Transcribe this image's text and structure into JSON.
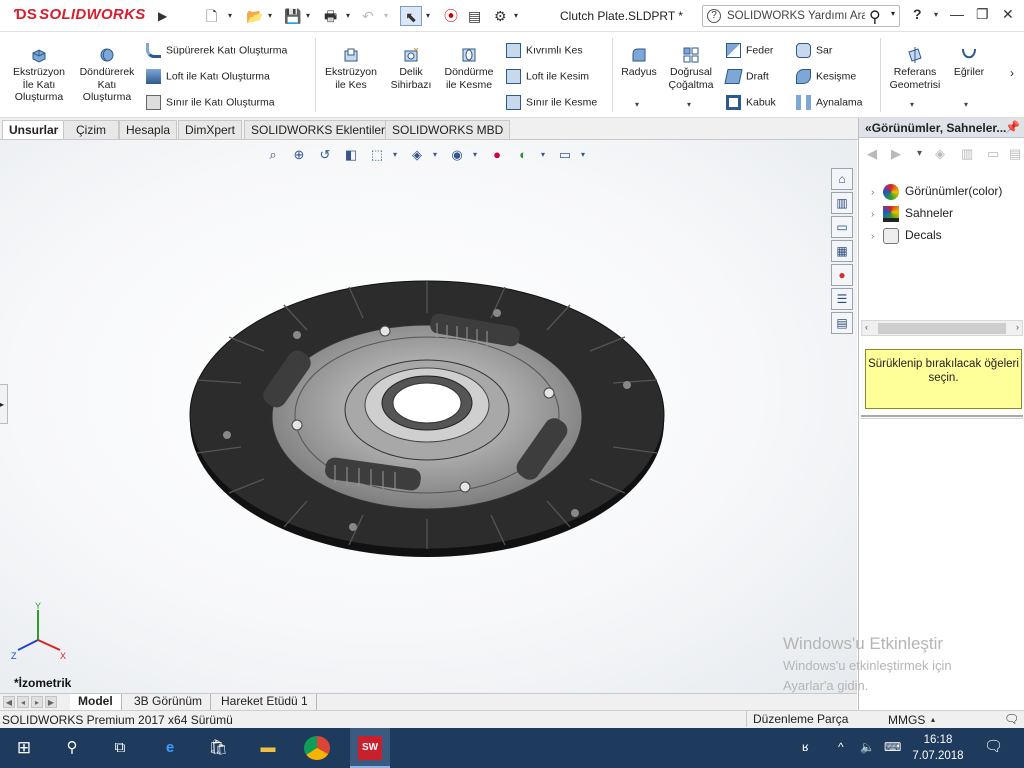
{
  "app": {
    "logo_text": "SOLIDWORKS",
    "document_title": "Clutch Plate.SLDPRT *",
    "help_search_placeholder": "SOLIDWORKS Yardımı Ara",
    "help_button": "?"
  },
  "ribbon": {
    "groups": [
      {
        "label": "Ekstrüzyon İle Katı Oluşturma",
        "lines": [
          "Ekstrüzyon",
          "İle Katı",
          "Oluşturma"
        ]
      },
      {
        "label": "Döndürerek Katı Oluşturma",
        "lines": [
          "Döndürerek",
          "Katı",
          "Oluşturma"
        ]
      }
    ],
    "sweep_loft": [
      "Süpürerek Katı Oluşturma",
      "Loft ile Katı Oluşturma",
      "Sınır ile Katı Oluşturma"
    ],
    "cut": {
      "extrude_cut": [
        "Ekstrüzyon",
        "ile Kes"
      ],
      "hole_wizard": [
        "Delik",
        "Sihirbazı"
      ],
      "revolve_cut": [
        "Döndürme",
        "ile Kesme"
      ]
    },
    "cut_small": [
      "Kıvrımlı Kes",
      "Loft ile Kesim",
      "Sınır ile Kesme"
    ],
    "fillet": "Radyus",
    "linear_pattern": [
      "Doğrusal",
      "Çoğaltma"
    ],
    "features_col1": [
      "Feder",
      "Draft",
      "Kabuk"
    ],
    "features_col2": [
      "Sar",
      "Kesişme",
      "Aynalama"
    ],
    "ref_geometry": [
      "Referans",
      "Geometrisi"
    ],
    "curves": "Eğriler"
  },
  "tabs": [
    "Unsurlar",
    "Çizim",
    "Hesapla",
    "DimXpert",
    "SOLIDWORKS Eklentileri",
    "SOLIDWORKS MBD"
  ],
  "active_tab": "Unsurlar",
  "viewport": {
    "view_orientation": "*İzometrik",
    "axis_labels": {
      "x": "X",
      "y": "Y",
      "z": "Z"
    }
  },
  "bottom_tabs": [
    "Model",
    "3B Görünüm",
    "Hareket Etüdü 1"
  ],
  "status": {
    "version": "SOLIDWORKS Premium 2017 x64 Sürümü",
    "mode": "Düzenleme Parça",
    "units": "MMGS"
  },
  "taskpane": {
    "header": "Görünümler, Sahneler...",
    "tree": [
      "Görünümler(color)",
      "Sahneler",
      "Decals"
    ],
    "message": "Sürüklenip bırakılacak öğeleri seçin."
  },
  "watermark": {
    "title": "Windows'u Etkinleştir",
    "line1": "Windows'u etkinleştirmek için",
    "line2": "Ayarlar'a gidin."
  },
  "taskbar": {
    "time": "16:18",
    "date": "7.07.2018"
  },
  "colors": {
    "brand": "#d81e2c",
    "taskbar": "#1e3a5c",
    "tooltip_bg": "#ffff99"
  }
}
